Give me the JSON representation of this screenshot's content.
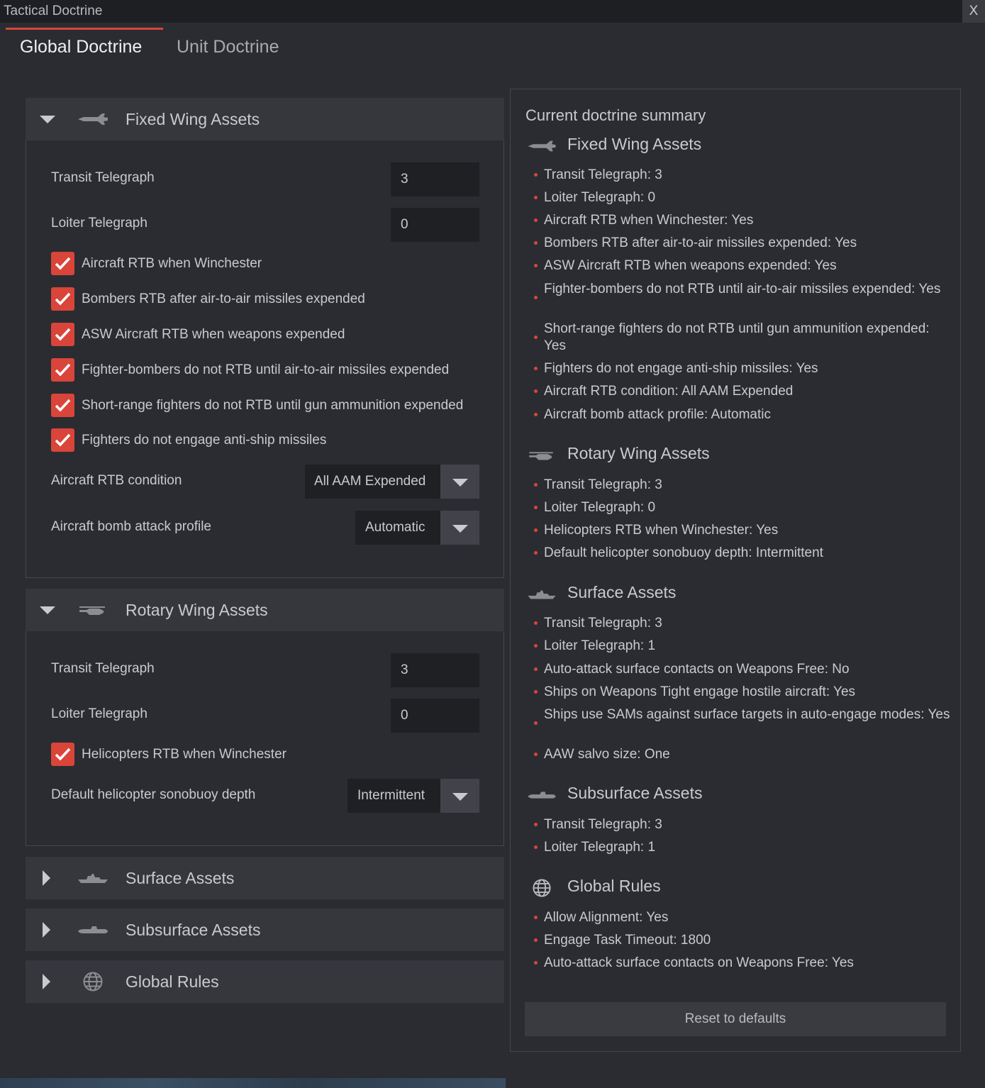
{
  "window": {
    "title": "Tactical Doctrine",
    "close_label": "X"
  },
  "tabs": [
    {
      "label": "Global Doctrine"
    },
    {
      "label": "Unit Doctrine"
    }
  ],
  "fixed_wing": {
    "title": "Fixed Wing Assets",
    "transit_label": "Transit Telegraph",
    "transit_value": "3",
    "loiter_label": "Loiter Telegraph",
    "loiter_value": "0",
    "checks": [
      "Aircraft RTB when Winchester",
      "Bombers RTB after air-to-air missiles expended",
      "ASW Aircraft RTB when weapons expended",
      "Fighter-bombers do not RTB until air-to-air missiles expended",
      "Short-range fighters do not RTB until gun ammunition expended",
      "Fighters do not engage anti-ship missiles"
    ],
    "rtb_condition_label": "Aircraft RTB condition",
    "rtb_condition_value": "All AAM Expended",
    "bomb_profile_label": "Aircraft bomb attack profile",
    "bomb_profile_value": "Automatic"
  },
  "rotary_wing": {
    "title": "Rotary Wing Assets",
    "transit_label": "Transit Telegraph",
    "transit_value": "3",
    "loiter_label": "Loiter Telegraph",
    "loiter_value": "0",
    "check": "Helicopters RTB when Winchester",
    "sonobuoy_label": "Default helicopter sonobuoy depth",
    "sonobuoy_value": "Intermittent"
  },
  "collapsed_sections": [
    {
      "title": "Surface Assets",
      "icon": "ship-icon"
    },
    {
      "title": "Subsurface Assets",
      "icon": "submarine-icon"
    },
    {
      "title": "Global Rules",
      "icon": "globe-icon"
    }
  ],
  "summary": {
    "title": "Current doctrine summary",
    "groups": [
      {
        "title": "Fixed Wing Assets",
        "icon": "jet-icon",
        "items": [
          "Transit Telegraph: 3",
          "Loiter Telegraph: 0",
          "Aircraft RTB when Winchester: Yes",
          "Bombers RTB after air-to-air missiles expended: Yes",
          "ASW Aircraft RTB when weapons expended: Yes",
          "Fighter-bombers do not RTB until air-to-air missiles expended: Yes",
          "Short-range fighters do not RTB until gun ammunition expended: Yes",
          "Fighters do not engage anti-ship missiles: Yes",
          "Aircraft RTB condition: All AAM Expended",
          "Aircraft bomb attack profile: Automatic"
        ]
      },
      {
        "title": "Rotary Wing Assets",
        "icon": "helicopter-icon",
        "items": [
          "Transit Telegraph: 3",
          "Loiter Telegraph: 0",
          "Helicopters RTB when Winchester: Yes",
          "Default helicopter sonobuoy depth: Intermittent"
        ]
      },
      {
        "title": "Surface Assets",
        "icon": "ship-icon",
        "items": [
          "Transit Telegraph: 3",
          "Loiter Telegraph: 1",
          "Auto-attack surface contacts on Weapons Free: No",
          "Ships on Weapons Tight engage hostile aircraft: Yes",
          "Ships use SAMs against surface targets in auto-engage modes: Yes",
          "AAW salvo size: One"
        ]
      },
      {
        "title": "Subsurface Assets",
        "icon": "submarine-icon",
        "items": [
          "Transit Telegraph: 3",
          "Loiter Telegraph: 1"
        ]
      },
      {
        "title": "Global Rules",
        "icon": "globe-icon",
        "items": [
          "Allow Alignment: Yes",
          "Engage Task Timeout: 1800",
          "Auto-attack surface contacts on Weapons Free: Yes"
        ]
      }
    ],
    "reset_label": "Reset to defaults"
  },
  "colors": {
    "accent": "#d9453a",
    "background": "#2b2c31",
    "panel_header": "#36373d",
    "input_bg": "#1f2024"
  }
}
